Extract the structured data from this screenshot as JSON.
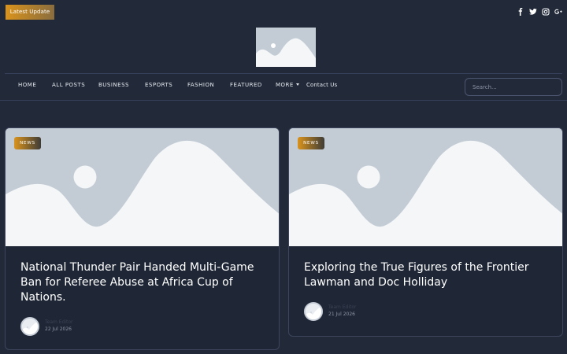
{
  "header": {
    "latest_update_label": "Latest Update",
    "social_icons": [
      "facebook-icon",
      "twitter-icon",
      "instagram-icon",
      "google-plus-icon"
    ]
  },
  "nav": {
    "items": [
      {
        "label": "HOME"
      },
      {
        "label": "ALL POSTS"
      },
      {
        "label": "BUSINESS"
      },
      {
        "label": "ESPORTS"
      },
      {
        "label": "FASHION"
      },
      {
        "label": "FEATURED"
      },
      {
        "label": "MORE"
      },
      {
        "label": "Contact Us"
      }
    ],
    "search_placeholder": "Search..."
  },
  "posts": [
    {
      "badge": "NEWS",
      "title": "National Thunder Pair Handed Multi-Game Ban for Referee Abuse at Africa Cup of Nations.",
      "author": "Team Editor",
      "date": "22 Jul 2026"
    },
    {
      "badge": "NEWS",
      "title": "Exploring the True Figures of the Frontier Lawman and Doc Holliday",
      "author": "Team Editor",
      "date": "21 Jul 2026"
    }
  ],
  "colors": {
    "background": "#222a3a",
    "accent_gold": "#d9931c",
    "placeholder_gray": "#c3ccd5"
  }
}
